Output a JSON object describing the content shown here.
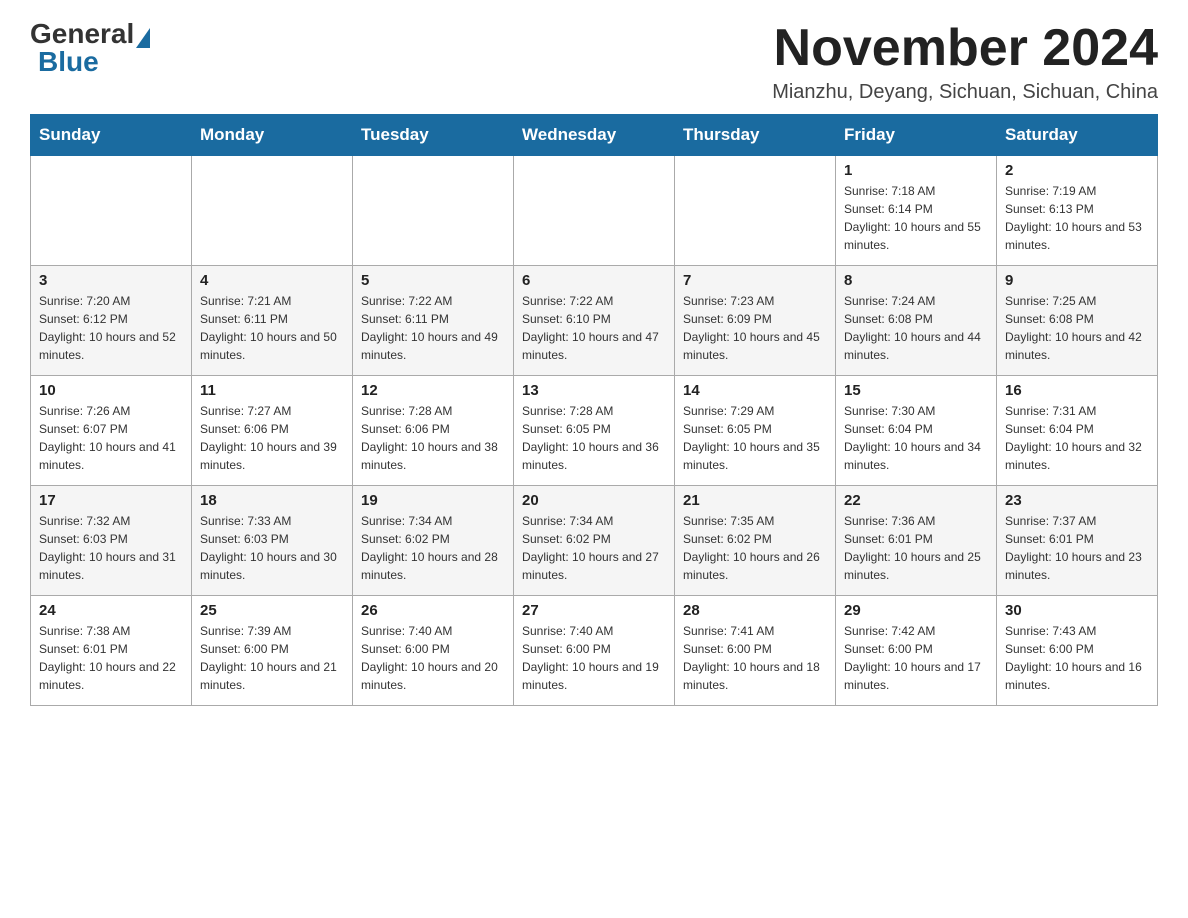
{
  "logo": {
    "general": "General",
    "blue": "Blue"
  },
  "header": {
    "title": "November 2024",
    "subtitle": "Mianzhu, Deyang, Sichuan, Sichuan, China"
  },
  "days_of_week": [
    "Sunday",
    "Monday",
    "Tuesday",
    "Wednesday",
    "Thursday",
    "Friday",
    "Saturday"
  ],
  "weeks": [
    [
      {
        "day": "",
        "info": ""
      },
      {
        "day": "",
        "info": ""
      },
      {
        "day": "",
        "info": ""
      },
      {
        "day": "",
        "info": ""
      },
      {
        "day": "",
        "info": ""
      },
      {
        "day": "1",
        "info": "Sunrise: 7:18 AM\nSunset: 6:14 PM\nDaylight: 10 hours and 55 minutes."
      },
      {
        "day": "2",
        "info": "Sunrise: 7:19 AM\nSunset: 6:13 PM\nDaylight: 10 hours and 53 minutes."
      }
    ],
    [
      {
        "day": "3",
        "info": "Sunrise: 7:20 AM\nSunset: 6:12 PM\nDaylight: 10 hours and 52 minutes."
      },
      {
        "day": "4",
        "info": "Sunrise: 7:21 AM\nSunset: 6:11 PM\nDaylight: 10 hours and 50 minutes."
      },
      {
        "day": "5",
        "info": "Sunrise: 7:22 AM\nSunset: 6:11 PM\nDaylight: 10 hours and 49 minutes."
      },
      {
        "day": "6",
        "info": "Sunrise: 7:22 AM\nSunset: 6:10 PM\nDaylight: 10 hours and 47 minutes."
      },
      {
        "day": "7",
        "info": "Sunrise: 7:23 AM\nSunset: 6:09 PM\nDaylight: 10 hours and 45 minutes."
      },
      {
        "day": "8",
        "info": "Sunrise: 7:24 AM\nSunset: 6:08 PM\nDaylight: 10 hours and 44 minutes."
      },
      {
        "day": "9",
        "info": "Sunrise: 7:25 AM\nSunset: 6:08 PM\nDaylight: 10 hours and 42 minutes."
      }
    ],
    [
      {
        "day": "10",
        "info": "Sunrise: 7:26 AM\nSunset: 6:07 PM\nDaylight: 10 hours and 41 minutes."
      },
      {
        "day": "11",
        "info": "Sunrise: 7:27 AM\nSunset: 6:06 PM\nDaylight: 10 hours and 39 minutes."
      },
      {
        "day": "12",
        "info": "Sunrise: 7:28 AM\nSunset: 6:06 PM\nDaylight: 10 hours and 38 minutes."
      },
      {
        "day": "13",
        "info": "Sunrise: 7:28 AM\nSunset: 6:05 PM\nDaylight: 10 hours and 36 minutes."
      },
      {
        "day": "14",
        "info": "Sunrise: 7:29 AM\nSunset: 6:05 PM\nDaylight: 10 hours and 35 minutes."
      },
      {
        "day": "15",
        "info": "Sunrise: 7:30 AM\nSunset: 6:04 PM\nDaylight: 10 hours and 34 minutes."
      },
      {
        "day": "16",
        "info": "Sunrise: 7:31 AM\nSunset: 6:04 PM\nDaylight: 10 hours and 32 minutes."
      }
    ],
    [
      {
        "day": "17",
        "info": "Sunrise: 7:32 AM\nSunset: 6:03 PM\nDaylight: 10 hours and 31 minutes."
      },
      {
        "day": "18",
        "info": "Sunrise: 7:33 AM\nSunset: 6:03 PM\nDaylight: 10 hours and 30 minutes."
      },
      {
        "day": "19",
        "info": "Sunrise: 7:34 AM\nSunset: 6:02 PM\nDaylight: 10 hours and 28 minutes."
      },
      {
        "day": "20",
        "info": "Sunrise: 7:34 AM\nSunset: 6:02 PM\nDaylight: 10 hours and 27 minutes."
      },
      {
        "day": "21",
        "info": "Sunrise: 7:35 AM\nSunset: 6:02 PM\nDaylight: 10 hours and 26 minutes."
      },
      {
        "day": "22",
        "info": "Sunrise: 7:36 AM\nSunset: 6:01 PM\nDaylight: 10 hours and 25 minutes."
      },
      {
        "day": "23",
        "info": "Sunrise: 7:37 AM\nSunset: 6:01 PM\nDaylight: 10 hours and 23 minutes."
      }
    ],
    [
      {
        "day": "24",
        "info": "Sunrise: 7:38 AM\nSunset: 6:01 PM\nDaylight: 10 hours and 22 minutes."
      },
      {
        "day": "25",
        "info": "Sunrise: 7:39 AM\nSunset: 6:00 PM\nDaylight: 10 hours and 21 minutes."
      },
      {
        "day": "26",
        "info": "Sunrise: 7:40 AM\nSunset: 6:00 PM\nDaylight: 10 hours and 20 minutes."
      },
      {
        "day": "27",
        "info": "Sunrise: 7:40 AM\nSunset: 6:00 PM\nDaylight: 10 hours and 19 minutes."
      },
      {
        "day": "28",
        "info": "Sunrise: 7:41 AM\nSunset: 6:00 PM\nDaylight: 10 hours and 18 minutes."
      },
      {
        "day": "29",
        "info": "Sunrise: 7:42 AM\nSunset: 6:00 PM\nDaylight: 10 hours and 17 minutes."
      },
      {
        "day": "30",
        "info": "Sunrise: 7:43 AM\nSunset: 6:00 PM\nDaylight: 10 hours and 16 minutes."
      }
    ]
  ]
}
